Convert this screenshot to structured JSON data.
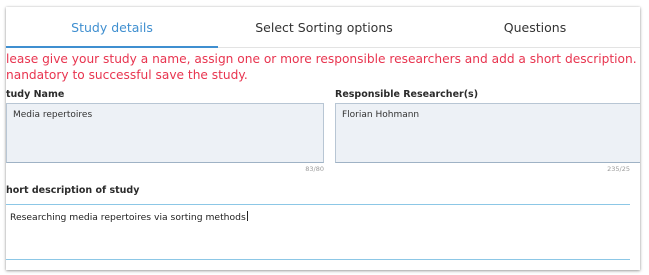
{
  "tabs": [
    {
      "label": "Study details",
      "active": true
    },
    {
      "label": "Select Sorting options",
      "active": false
    },
    {
      "label": "Questions",
      "active": false
    }
  ],
  "notice": {
    "line1": "lease give your study a name, assign one or more responsible researchers and add a short description. All information is",
    "line2": "nandatory to successful save the study."
  },
  "study_name": {
    "label": "tudy Name",
    "value": "Media repertoires",
    "counter": "83/80"
  },
  "researchers": {
    "label": "Responsible Researcher(s)",
    "value": "Florian Hohmann",
    "counter": "235/25"
  },
  "description": {
    "label": "hort description of study",
    "value": "Researching media repertoires via sorting methods"
  },
  "colors": {
    "accent": "#3f8fd0",
    "notice": "#e8344f",
    "field_bg": "#edf1f6"
  }
}
